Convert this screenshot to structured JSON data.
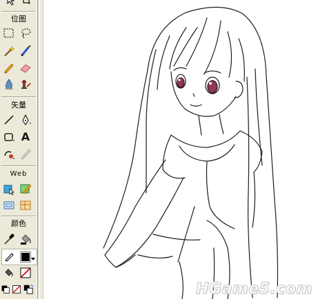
{
  "toolbox": {
    "sections": {
      "bitmap_label": "位图",
      "vector_label": "矢量",
      "web_label": "Web",
      "colors_label": "颜色"
    },
    "tools": [
      {
        "name": "select-icon"
      },
      {
        "name": "lasso-icon"
      },
      {
        "name": "magic-wand-icon"
      },
      {
        "name": "brush-icon"
      },
      {
        "name": "pencil-icon"
      },
      {
        "name": "eraser-icon"
      },
      {
        "name": "blur-icon"
      },
      {
        "name": "rubber-stamp-icon"
      },
      {
        "name": "line-icon"
      },
      {
        "name": "pen-icon"
      },
      {
        "name": "rectangle-icon"
      },
      {
        "name": "text-icon",
        "glyph": "A"
      },
      {
        "name": "freeform-icon"
      },
      {
        "name": "knife-icon"
      },
      {
        "name": "hotspot-icon"
      },
      {
        "name": "slice-icon"
      },
      {
        "name": "hide-slices-icon"
      },
      {
        "name": "show-slices-icon"
      },
      {
        "name": "eyedropper-icon"
      },
      {
        "name": "paint-bucket-icon"
      }
    ],
    "colors": {
      "stroke_color": "#000000",
      "fill_color": "#000000"
    }
  },
  "canvas": {
    "watermark": "HGame5.com"
  }
}
